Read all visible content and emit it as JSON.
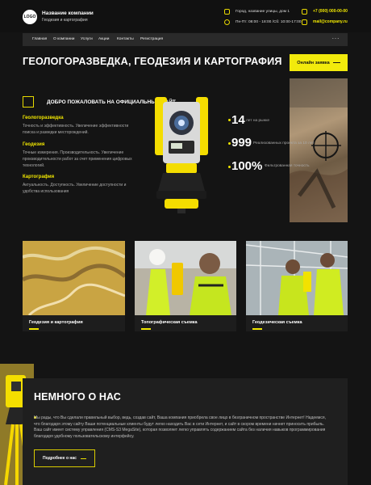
{
  "header": {
    "logo_text": "LOGO",
    "company_name": "Название компании",
    "company_sub": "Геодезия и картография",
    "address": "Город, название улицы, дом 1",
    "hours": "Пн-Пт: 08:00 - 18:00 /Сб: 10:00-17:00",
    "phone": "+7 (000) 000-00-00",
    "email": "mail@company.ru"
  },
  "nav": {
    "items": [
      "Главная",
      "О компании",
      "Услуги",
      "Акции",
      "Контакты",
      "Регистрация"
    ],
    "more": "···"
  },
  "hero": {
    "title": "ГЕОЛОГОРАЗВЕДКА, ГЕОДЕЗИЯ И КАРТОГРАФИЯ",
    "cta_label": "Онлайн заявка"
  },
  "welcome": {
    "title": "ДОБРО ПОЖАЛОВАТЬ НА ОФИЦИАЛЬНЫЙ САЙТ",
    "features": [
      {
        "title": "Геологоразведка",
        "text": "Точность и эффективность. Увеличение эффективности поиска и разведки месторождений."
      },
      {
        "title": "Геодезия",
        "text": "Точные измерения. Производительность. Увеличение производительности работ за счет применения цифровых технологий."
      },
      {
        "title": "Картография",
        "text": "Актуальность. Доступность. Увеличение доступности и удобства использования"
      }
    ],
    "stats": [
      {
        "value": "14",
        "label": "лет на рынке"
      },
      {
        "value": "999",
        "label": "Реализованных проекта за 10 лет"
      },
      {
        "value": "100%",
        "label": "Фильтрованная точность"
      }
    ]
  },
  "services": [
    {
      "label": "Геодезия и картография"
    },
    {
      "label": "Топографическая съемка"
    },
    {
      "label": "Геодезическая съемка"
    }
  ],
  "about": {
    "title": "НЕМНОГО О НАС",
    "text": "Мы рады, что Вы сделали правильный выбор, ведь, создав сайт, Ваша компания приобрела свое лицо в безграничном пространстве Интернет! Надеемся, что благодаря этому сайту Ваши потенциальные клиенты будут легко находить Вас в сети Интернет, и сайт в скором времени начнет приносить прибыль. Ваш сайт имеет систему управления (CMS-S3 MegaSite), которая позволяет легко управлять содержанием сайта без наличия навыков программирования благодаря удобному пользовательскому интерфейсу.",
    "button_label": "Подробнее о нас"
  },
  "colors": {
    "accent": "#f2ea0c",
    "background": "#141414"
  }
}
